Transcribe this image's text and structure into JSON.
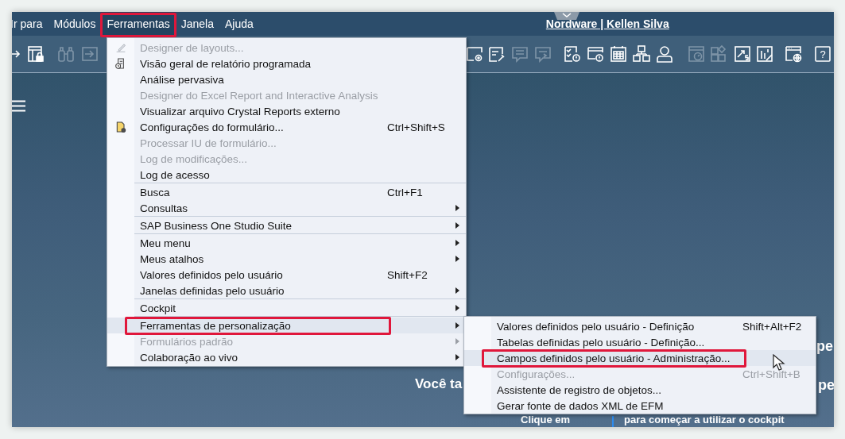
{
  "menubar": {
    "items": [
      {
        "label": "Ir para",
        "selected": false,
        "highlighted": false
      },
      {
        "label": "Módulos",
        "selected": false,
        "highlighted": false
      },
      {
        "label": "Ferramentas",
        "selected": true,
        "highlighted": true
      },
      {
        "label": "Janela",
        "selected": false,
        "highlighted": false
      },
      {
        "label": "Ajuda",
        "selected": false,
        "highlighted": false
      }
    ],
    "title": "Nordware | Kellen Silva"
  },
  "toolbar": {
    "left": [
      {
        "kind": "export",
        "disabled": false
      },
      {
        "kind": "formlock",
        "disabled": false
      },
      {
        "kind": "binoculars",
        "disabled": true
      },
      {
        "kind": "import",
        "disabled": true
      }
    ],
    "right": [
      {
        "kind": "formgear",
        "disabled": false
      },
      {
        "kind": "formwrench",
        "disabled": false
      },
      {
        "kind": "chat",
        "disabled": true
      },
      {
        "kind": "chatforward",
        "disabled": true
      },
      {
        "kind": "checklistalert",
        "disabled": false
      },
      {
        "kind": "windowalert",
        "disabled": false
      },
      {
        "kind": "calendar",
        "disabled": false
      },
      {
        "kind": "hierarchy",
        "disabled": false
      },
      {
        "kind": "user",
        "disabled": false
      },
      {
        "kind": "dashboard",
        "disabled": true
      },
      {
        "kind": "grid",
        "disabled": true
      },
      {
        "kind": "chartdollar",
        "disabled": false
      },
      {
        "kind": "chartpen",
        "disabled": false
      },
      {
        "kind": "globewindow",
        "disabled": false
      },
      {
        "kind": "help",
        "disabled": false,
        "label": "?"
      }
    ]
  },
  "background_texts": [
    {
      "kind": "side",
      "text": "pe"
    },
    {
      "kind": "headline",
      "text": "Você ta"
    },
    {
      "kind": "side2",
      "text": "pe"
    },
    {
      "kind": "hint_left",
      "text": "Clique em"
    },
    {
      "kind": "hint_right",
      "text": "para começar a utilizar o cockpit"
    }
  ],
  "menu": {
    "items": [
      {
        "kind": "item",
        "label": "Designer de layouts...",
        "disabled": true,
        "selected": false,
        "highlighted": false
      },
      {
        "kind": "item",
        "label": "Visão geral de relatório programada",
        "disabled": false,
        "selected": false,
        "highlighted": false
      },
      {
        "kind": "item",
        "label": "Análise pervasiva",
        "disabled": false,
        "selected": false,
        "highlighted": false
      },
      {
        "kind": "item",
        "label": "Designer do Excel Report and Interactive Analysis",
        "disabled": true,
        "selected": false,
        "highlighted": false
      },
      {
        "kind": "item",
        "label": "Visualizar arquivo Crystal Reports externo",
        "disabled": false,
        "selected": false,
        "highlighted": false
      },
      {
        "kind": "item",
        "label": "Configurações do formulário...",
        "shortcut": "Ctrl+Shift+S",
        "disabled": false,
        "selected": false,
        "highlighted": false
      },
      {
        "kind": "item",
        "label": "Processar IU de formulário...",
        "disabled": true,
        "selected": false,
        "highlighted": false
      },
      {
        "kind": "item",
        "label": "Log de modificações...",
        "disabled": true,
        "selected": false,
        "highlighted": false
      },
      {
        "kind": "item",
        "label": "Log de acesso",
        "disabled": false,
        "selected": false,
        "highlighted": false
      },
      {
        "kind": "separator"
      },
      {
        "kind": "item",
        "label": "Busca",
        "shortcut": "Ctrl+F1",
        "disabled": false,
        "selected": false,
        "highlighted": false
      },
      {
        "kind": "item",
        "label": "Consultas",
        "submenu": true,
        "disabled": false,
        "selected": false,
        "highlighted": false
      },
      {
        "kind": "separator"
      },
      {
        "kind": "item",
        "label": "SAP Business One Studio Suite",
        "submenu": true,
        "disabled": false,
        "selected": false,
        "highlighted": false
      },
      {
        "kind": "separator"
      },
      {
        "kind": "item",
        "label": "Meu menu",
        "submenu": true,
        "disabled": false,
        "selected": false,
        "highlighted": false
      },
      {
        "kind": "item",
        "label": "Meus atalhos",
        "submenu": true,
        "disabled": false,
        "selected": false,
        "highlighted": false
      },
      {
        "kind": "item",
        "label": "Valores definidos pelo usuário",
        "shortcut": "Shift+F2",
        "disabled": false,
        "selected": false,
        "highlighted": false
      },
      {
        "kind": "item",
        "label": "Janelas definidas pelo usuário",
        "submenu": true,
        "disabled": false,
        "selected": false,
        "highlighted": false
      },
      {
        "kind": "separator"
      },
      {
        "kind": "item",
        "label": "Cockpit",
        "submenu": true,
        "disabled": false,
        "selected": false,
        "highlighted": false
      },
      {
        "kind": "separator"
      },
      {
        "kind": "item",
        "label": "Ferramentas de personalização",
        "submenu": true,
        "disabled": false,
        "selected": true,
        "highlighted": true
      },
      {
        "kind": "item",
        "label": "Formulários padrão",
        "submenu": true,
        "disabled": true,
        "selected": false,
        "highlighted": false
      },
      {
        "kind": "item",
        "label": "Colaboração ao vivo",
        "submenu": true,
        "disabled": false,
        "selected": false,
        "highlighted": false
      }
    ]
  },
  "submenu": {
    "items": [
      {
        "kind": "item",
        "label": "Valores definidos pelo usuário - Definição",
        "shortcut": "Shift+Alt+F2",
        "disabled": false,
        "selected": false,
        "highlighted": false
      },
      {
        "kind": "item",
        "label": "Tabelas definidas pelo usuário - Definição...",
        "disabled": false,
        "selected": false,
        "highlighted": false
      },
      {
        "kind": "item",
        "label": "Campos definidos pelo usuário - Administração...",
        "disabled": false,
        "selected": true,
        "highlighted": true
      },
      {
        "kind": "item",
        "label": "Configurações...",
        "shortcut": "Ctrl+Shift+B",
        "disabled": true,
        "selected": false,
        "highlighted": false
      },
      {
        "kind": "item",
        "label": "Assistente de registro de objetos...",
        "disabled": false,
        "selected": false,
        "highlighted": false
      },
      {
        "kind": "item",
        "label": "Gerar fonte de dados XML de EFM",
        "disabled": false,
        "selected": false,
        "highlighted": false
      }
    ]
  }
}
